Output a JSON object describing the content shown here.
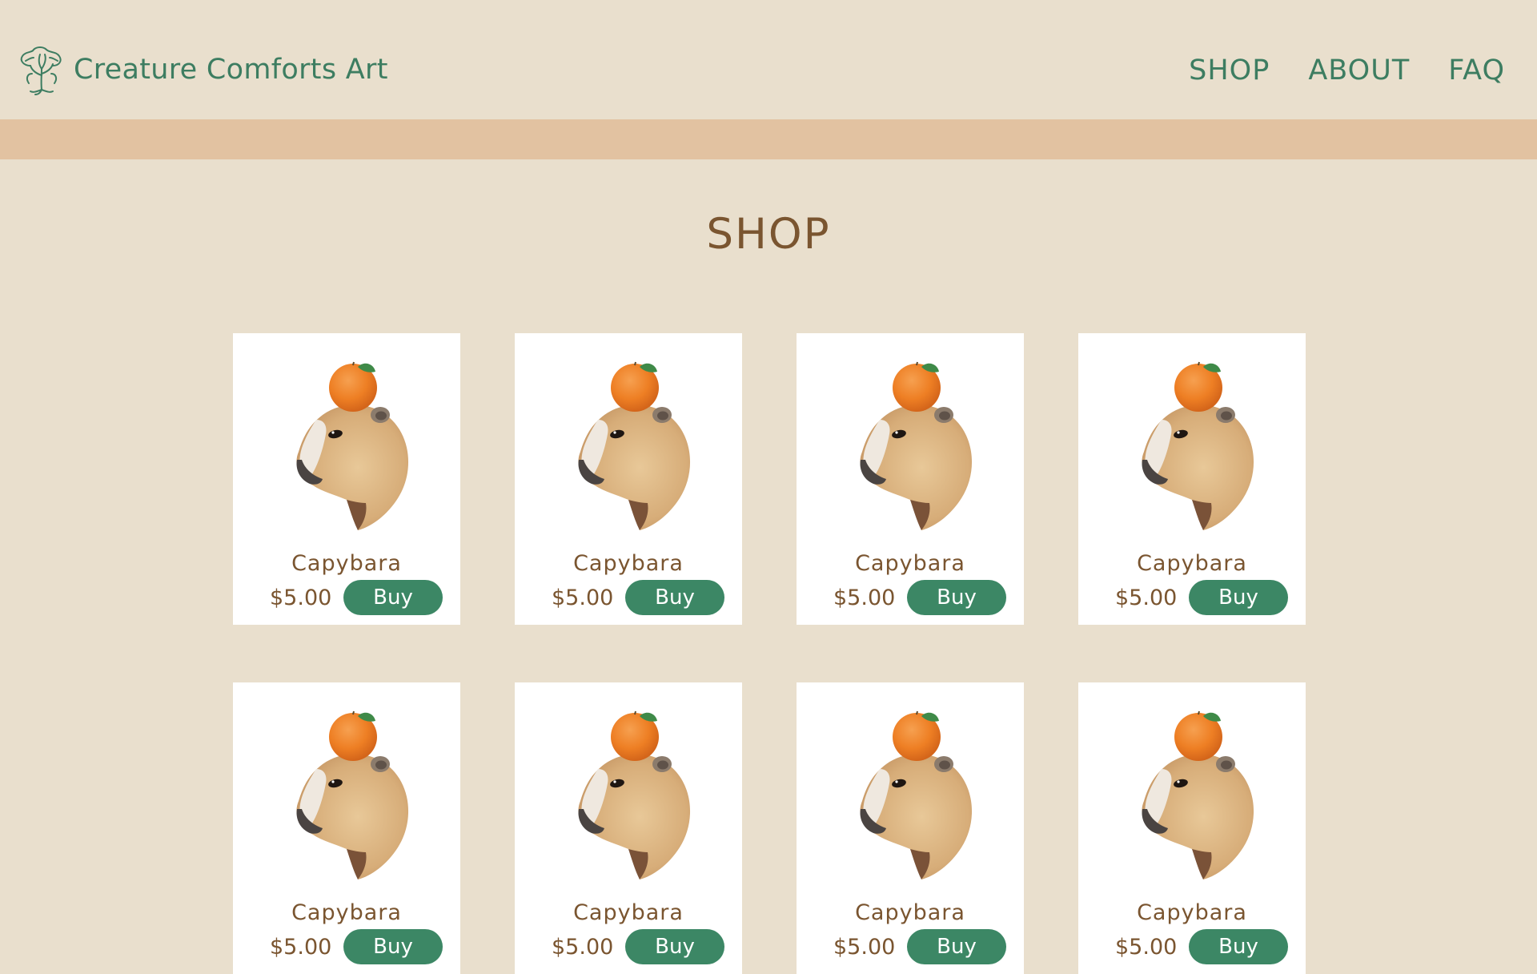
{
  "header": {
    "brand": "Creature Comforts Art",
    "nav": [
      "SHOP",
      "ABOUT",
      "FAQ"
    ]
  },
  "page": {
    "title": "SHOP"
  },
  "products": [
    {
      "name": "Capybara",
      "price": "$5.00",
      "buy_label": "Buy"
    },
    {
      "name": "Capybara",
      "price": "$5.00",
      "buy_label": "Buy"
    },
    {
      "name": "Capybara",
      "price": "$5.00",
      "buy_label": "Buy"
    },
    {
      "name": "Capybara",
      "price": "$5.00",
      "buy_label": "Buy"
    },
    {
      "name": "Capybara",
      "price": "$5.00",
      "buy_label": "Buy"
    },
    {
      "name": "Capybara",
      "price": "$5.00",
      "buy_label": "Buy"
    },
    {
      "name": "Capybara",
      "price": "$5.00",
      "buy_label": "Buy"
    },
    {
      "name": "Capybara",
      "price": "$5.00",
      "buy_label": "Buy"
    }
  ],
  "colors": {
    "background": "#e9dfcd",
    "band": "#e2c2a1",
    "brand_green": "#3d7d61",
    "button_green": "#3c8765",
    "text_brown": "#7a5530"
  },
  "icons": {
    "logo": "tree-icon",
    "product_art": "capybara-with-orange-icon"
  }
}
